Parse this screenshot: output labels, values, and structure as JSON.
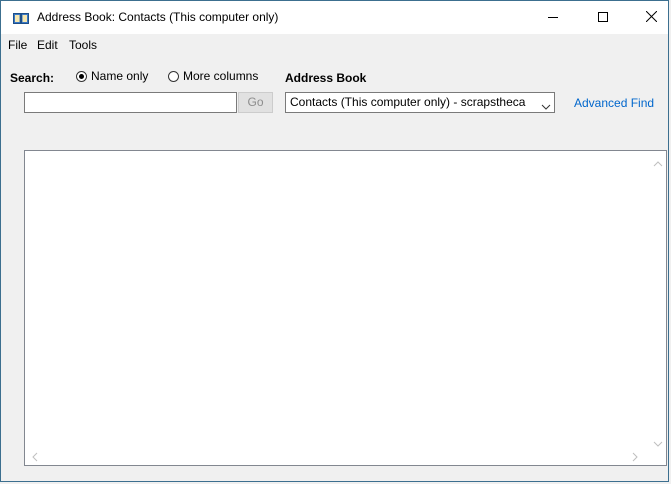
{
  "window": {
    "title": "Address Book: Contacts (This computer only)"
  },
  "menu": [
    "File",
    "Edit",
    "Tools"
  ],
  "search": {
    "label": "Search:",
    "options": [
      "Name only",
      "More columns"
    ],
    "selected": "Name only",
    "input_value": "",
    "go_label": "Go"
  },
  "address_book": {
    "label": "Address Book",
    "selected": "Contacts (This computer only) - scrapsthecа",
    "advanced_find": "Advanced Find"
  },
  "colors": {
    "link": "#0066cc",
    "border": "#828790"
  },
  "icons": {
    "title": "address-book-icon",
    "minimize": "minimize-icon",
    "maximize": "maximize-icon",
    "close": "close-icon",
    "dropdown": "chevron-down-icon"
  }
}
